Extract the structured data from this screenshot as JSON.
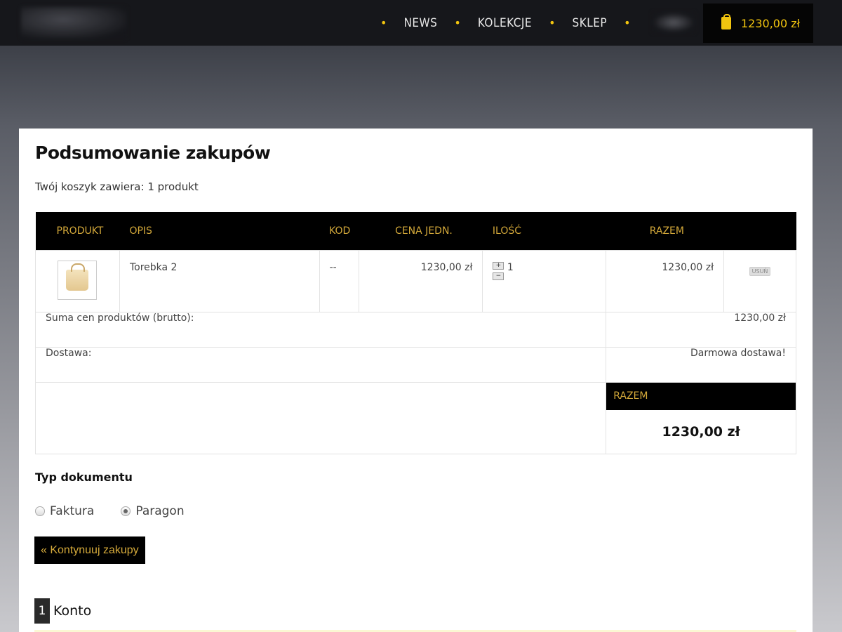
{
  "nav": {
    "items": [
      "NEWS",
      "KOLEKCJE",
      "SKLEP"
    ],
    "cart_total": "1230,00 zł",
    "accent": "#f1c40f"
  },
  "main": {
    "title": "Podsumowanie zakupów",
    "cart_count": "Twój koszyk zawiera: 1 produkt",
    "table": {
      "headers": [
        "PRODUKT",
        "OPIS",
        "KOD",
        "CENA JEDN.",
        "ILOŚĆ",
        "RAZEM"
      ],
      "rows": [
        {
          "description": "Torebka 2",
          "code": "--",
          "unit_price": "1230,00 zł",
          "qty_plus": "+",
          "qty_minus": "−",
          "quantity": "1",
          "total": "1230,00 zł",
          "remove_label": "USUŃ"
        }
      ]
    },
    "summary": {
      "subtotal_label": "Suma cen produktów (brutto):",
      "subtotal_value": "1230,00 zł",
      "shipping_label": "Dostawa:",
      "shipping_value": "Darmowa dostawa!",
      "total_label": "RAZEM",
      "total_value": "1230,00 zł"
    },
    "document_type": {
      "heading": "Typ dokumentu",
      "options": [
        "Faktura",
        "Paragon"
      ],
      "selected": "Paragon"
    },
    "continue_label": "« Kontynuuj zakupy",
    "section": {
      "number": "1",
      "title": "Konto"
    }
  }
}
